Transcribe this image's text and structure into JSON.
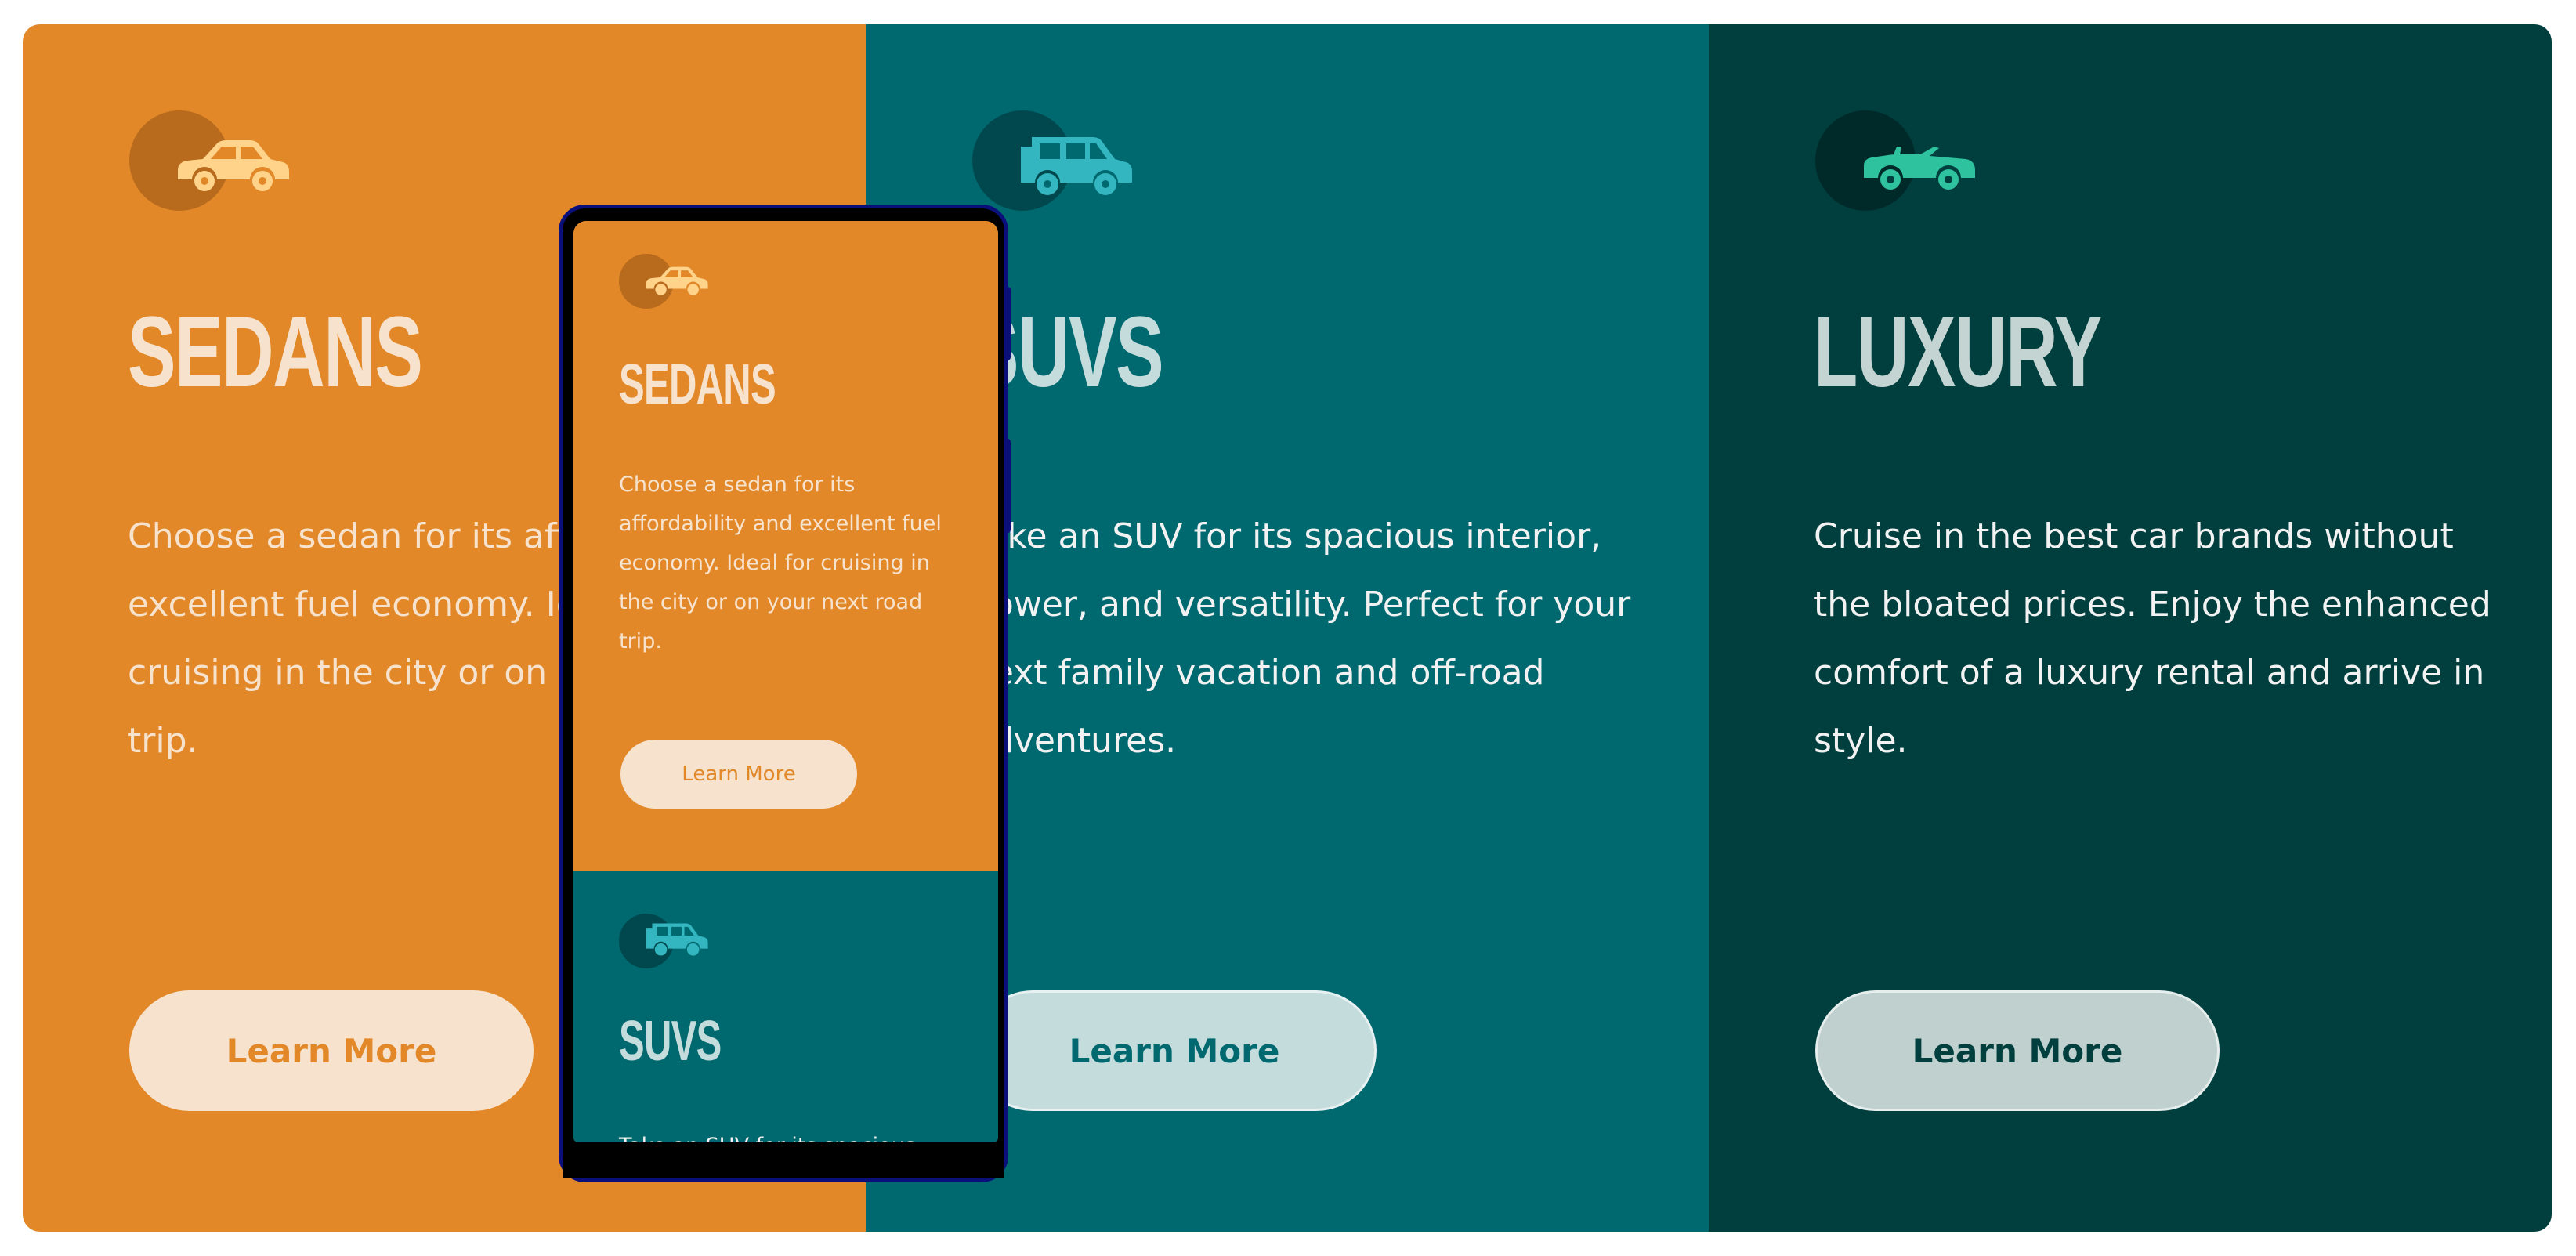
{
  "colors": {
    "sedan_bg": "#e28829",
    "suv_bg": "#006970",
    "luxury_bg": "#003f3e",
    "cream": "#f7e3cd",
    "light_text": "#f2f2f2",
    "sedan_icon": "#ffd38a",
    "suv_icon": "#33b6bf",
    "luxury_icon": "#2ec29e"
  },
  "panels": [
    {
      "id": "sedans",
      "title": "SEDANS",
      "description": "Choose a sedan for its affordability and excellent fuel economy. Ideal for cruising in the city or on your next road trip.",
      "button_label": "Learn More",
      "icon": "sedan-icon"
    },
    {
      "id": "suvs",
      "title": "SUVS",
      "description": "Take an SUV for its spacious interior, power, and versatility. Perfect for your next family vacation and off-road adventures.",
      "button_label": "Learn More",
      "icon": "suv-icon"
    },
    {
      "id": "luxury",
      "title": "LUXURY",
      "description": "Cruise in the best car brands without the bloated prices. Enjoy the enhanced comfort of a luxury rental and arrive in style.",
      "button_label": "Learn More",
      "icon": "luxury-car-icon"
    }
  ],
  "mobile": {
    "sedan": {
      "title": "SEDANS",
      "description": "Choose a sedan for its affordability and excellent fuel economy. Ideal for cruising in the city or on your next road trip.",
      "button_label": "Learn More"
    },
    "suv": {
      "title": "SUVS",
      "description_partial": "Take an SUV for its spacious"
    }
  }
}
